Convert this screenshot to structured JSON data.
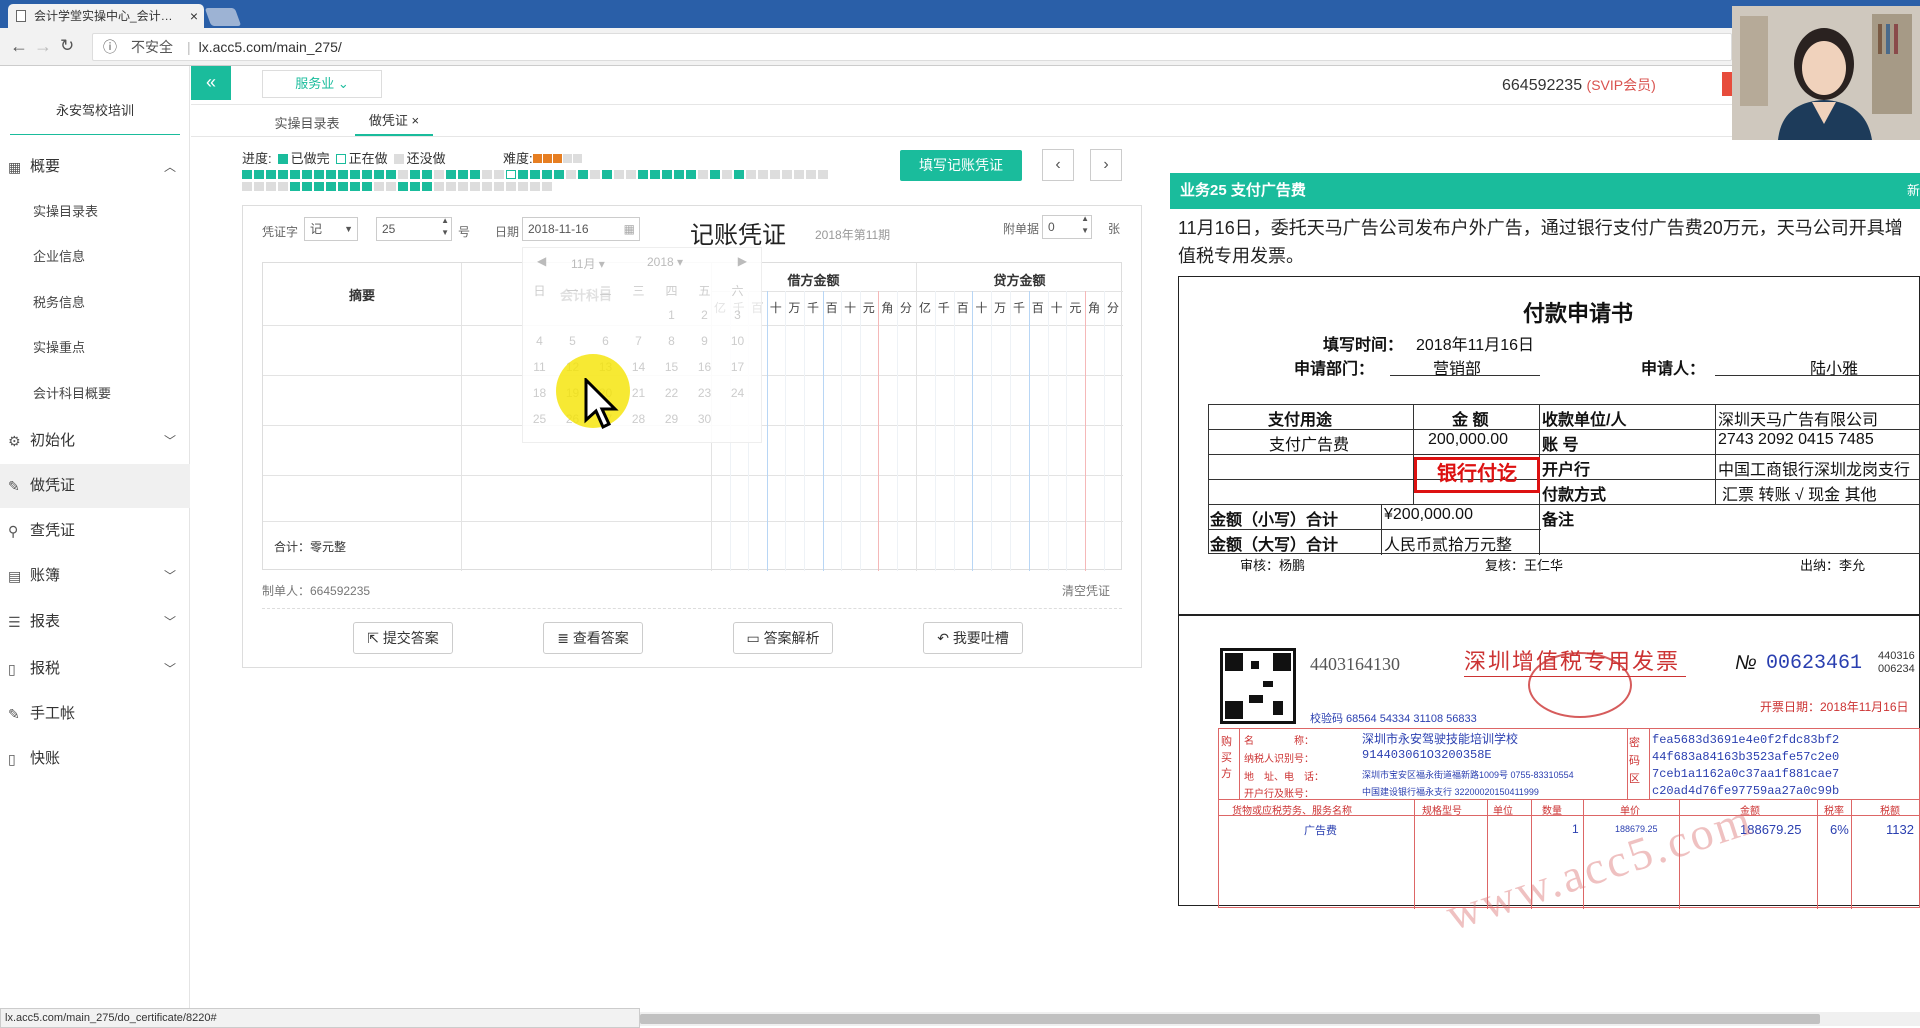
{
  "browser": {
    "tab_title": "会计学堂实操中心_会计…",
    "not_secure": "不安全",
    "url": "lx.acc5.com/main_275/"
  },
  "sidebar": {
    "school": "永安驾校培训",
    "items": [
      {
        "label": "概要",
        "icon": "grid-icon"
      },
      {
        "label": "实操目录表"
      },
      {
        "label": "企业信息"
      },
      {
        "label": "税务信息"
      },
      {
        "label": "实操重点"
      },
      {
        "label": "会计科目概要"
      },
      {
        "label": "初始化",
        "icon": "gear-icon"
      },
      {
        "label": "做凭证",
        "icon": "pen-icon"
      },
      {
        "label": "查凭证",
        "icon": "search-icon"
      },
      {
        "label": "账簿",
        "icon": "book-icon"
      },
      {
        "label": "报表",
        "icon": "list-icon"
      },
      {
        "label": "报税",
        "icon": "doc-icon"
      },
      {
        "label": "手工帐",
        "icon": "pen-icon"
      },
      {
        "label": "快账",
        "icon": "doc-icon"
      }
    ]
  },
  "header": {
    "collapse": "«",
    "service": "服务业",
    "user_id": "664592235",
    "member": "(SVIP会员)"
  },
  "tabs": [
    "实操目录表",
    "做凭证"
  ],
  "progress": {
    "label": "进度:",
    "done": "已做完",
    "doing": "正在做",
    "todo": "还没做",
    "difficulty": "难度:",
    "stars_on": 3,
    "stars_total": 5
  },
  "buttons": {
    "fill": "填写记账凭证",
    "prev": "‹",
    "next": "›"
  },
  "voucher": {
    "type_label": "凭证字",
    "type_value": "记",
    "number": "25",
    "number_unit": "号",
    "date_label": "日期",
    "date_value": "2018-11-16",
    "title": "记账凭证",
    "period": "2018年第11期",
    "attach_label": "附单据",
    "attach_value": "0",
    "attach_unit": "张",
    "col_summary": "摘要",
    "col_account": "会计科目",
    "col_debit": "借方金额",
    "col_credit": "贷方金额",
    "digits": [
      "亿",
      "千",
      "百",
      "十",
      "万",
      "千",
      "百",
      "十",
      "元",
      "角",
      "分"
    ],
    "total": "合计：零元整",
    "maker": "制单人：664592235",
    "clear": "清空凭证"
  },
  "actions": [
    {
      "label": "提交答案",
      "icon": "export-icon"
    },
    {
      "label": "查看答案",
      "icon": "database-icon"
    },
    {
      "label": "答案解析",
      "icon": "folder-icon"
    },
    {
      "label": "我要吐槽",
      "icon": "reply-icon"
    }
  ],
  "datepicker": {
    "month": "11月",
    "year": "2018",
    "weekdays": [
      "日",
      "一",
      "二",
      "三",
      "四",
      "五",
      "六"
    ],
    "days": [
      "",
      "",
      "",
      "",
      "1",
      "2",
      "3",
      "4",
      "5",
      "6",
      "7",
      "8",
      "9",
      "10",
      "11",
      "12",
      "13",
      "14",
      "15",
      "16",
      "17",
      "18",
      "19",
      "20",
      "21",
      "22",
      "23",
      "24",
      "25",
      "26",
      "27",
      "28",
      "29",
      "30",
      ""
    ]
  },
  "business": {
    "title": "业务25 支付广告费",
    "new": "新",
    "description": "11月16日，委托天马广告公司发布户外广告，通过银行支付广告费20万元，天马公司开具增值税专用发票。"
  },
  "payment_form": {
    "title": "付款申请书",
    "fill_time_label": "填写时间：",
    "fill_time": "2018年11月16日",
    "dept_label": "申请部门：",
    "dept": "营销部",
    "applicant_label": "申请人：",
    "applicant": "陆小雅",
    "purpose_h": "支付用途",
    "amount_h": "金 额",
    "payee_h": "收款单位/人",
    "payee": "深圳天马广告有限公司",
    "purpose": "支付广告费",
    "amount": "200,000.00",
    "account_h": "账 号",
    "account": "2743 2092 0415 7485",
    "bank_h": "开户行",
    "bank": "中国工商银行深圳龙岗支行",
    "stamp": "银行付讫",
    "method_h": "付款方式",
    "method": "汇票  转账 √  现金    其他",
    "small_h": "金额（小写）合计",
    "small": "¥200,000.00",
    "note_h": "备注",
    "big_h": "金额（大写）合计",
    "big": "人民币贰拾万元整",
    "auditor": "审核：杨鹏",
    "reviewer": "复核：王仁华",
    "cashier": "出纳：李允"
  },
  "invoice": {
    "code": "4403164130",
    "title": "深圳增值税专用发票",
    "no_label": "№",
    "no": "00623461",
    "side_code": "440316\n006234",
    "check": "校验码 68564 54334 31108 56833",
    "issue_date": "开票日期：2018年11月16日",
    "buyer_name_label": "名　　　　称：",
    "buyer_name": "深圳市永安驾驶技能培训学校",
    "taxid_label": "纳税人识别号：",
    "taxid": "914403061O3200358E",
    "address_label": "地　址、电　话：",
    "address": "深圳市宝安区福永街道福新路1009号 0755-83310554",
    "bank_label": "开户行及账号：",
    "bank": "中国建设银行福永支行 32200020150411999",
    "cipher": [
      "fea5683d3691e4e0f2fdc83bf2",
      "44f683a84163b3523afe57c2e0",
      "7ceb1a1162a0c37aa1f881cae7",
      "c20ad4d76fe97759aa27a0c99b"
    ],
    "item_header": "货物或应税劳务、服务名称",
    "spec_header": "规格型号",
    "unit_header": "单位",
    "qty_header": "数量",
    "price_header": "单价",
    "amount_header": "金额",
    "rate_header": "税率",
    "tax_header": "税额",
    "item": "广告费",
    "qty": "1",
    "price": "188679.25",
    "amount": "188679.25",
    "rate": "6%",
    "tax": "1132",
    "buyer_side": "购买方",
    "cipher_side": "密码区",
    "watermark": "www.acc5.com"
  },
  "status_url": "lx.acc5.com/main_275/do_certificate/8220#",
  "colors": {
    "accent": "#1abc9c",
    "done": "#1abc9c",
    "todo": "#dddddd",
    "red": "#d9534f"
  }
}
